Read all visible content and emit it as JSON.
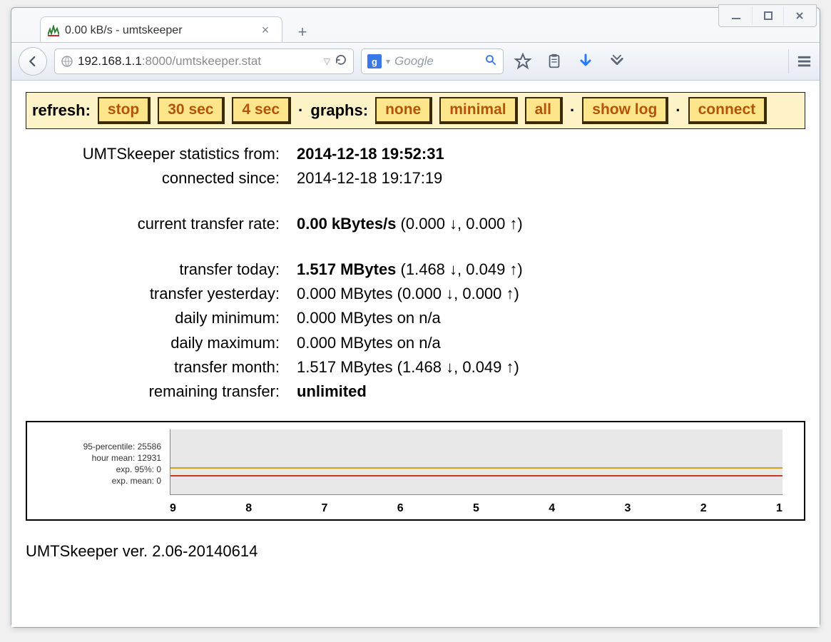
{
  "tab": {
    "title": "0.00 kB/s - umtskeeper"
  },
  "url": {
    "prefix": "192.168.1.1",
    "suffix": ":8000/umtskeeper.stat"
  },
  "search": {
    "placeholder": "Google",
    "engine_letter": "g"
  },
  "controls": {
    "refresh_label": "refresh:",
    "btn_stop": "stop",
    "btn_30s": "30 sec",
    "btn_4s": "4 sec",
    "graphs_label": "graphs:",
    "btn_none": "none",
    "btn_minimal": "minimal",
    "btn_all": "all",
    "btn_showlog": "show log",
    "btn_connect": "connect",
    "separator": "·"
  },
  "stats": {
    "from_label": "UMTSkeeper statistics from:",
    "from_value": "2014-12-18 19:52:31",
    "connected_label": "connected since:",
    "connected_value": "2014-12-18 19:17:19",
    "rate_label": "current transfer rate:",
    "rate_bold": "0.00 kBytes/s",
    "rate_rest": " (0.000 ↓, 0.000 ↑)",
    "today_label": "transfer today:",
    "today_bold": "1.517 MBytes",
    "today_rest": " (1.468 ↓, 0.049 ↑)",
    "yesterday_label": "transfer yesterday:",
    "yesterday_value": "0.000 MBytes (0.000 ↓, 0.000 ↑)",
    "dmin_label": "daily minimum:",
    "dmin_value": "0.000 MBytes on n/a",
    "dmax_label": "daily maximum:",
    "dmax_value": "0.000 MBytes on n/a",
    "month_label": "transfer month:",
    "month_value": "1.517 MBytes (1.468 ↓, 0.049 ↑)",
    "remain_label": "remaining transfer:",
    "remain_value": "unlimited"
  },
  "graph": {
    "labels": {
      "p95": "95-percentile: 25586",
      "hmean": "hour mean: 12931",
      "exp95": "exp. 95%: 0",
      "expmean": "exp. mean: 0"
    },
    "ticks": [
      "9",
      "8",
      "7",
      "6",
      "5",
      "4",
      "3",
      "2",
      "1"
    ]
  },
  "footer": "UMTSkeeper ver. 2.06-20140614",
  "chart_data": {
    "type": "line",
    "title": "",
    "xlabel": "",
    "ylabel": "",
    "x": [
      9,
      8,
      7,
      6,
      5,
      4,
      3,
      2,
      1
    ],
    "series": [
      {
        "name": "95-percentile",
        "value": 25586
      },
      {
        "name": "hour mean",
        "value": 12931
      },
      {
        "name": "exp. 95%",
        "value": 0
      },
      {
        "name": "exp. mean",
        "value": 0
      }
    ]
  }
}
